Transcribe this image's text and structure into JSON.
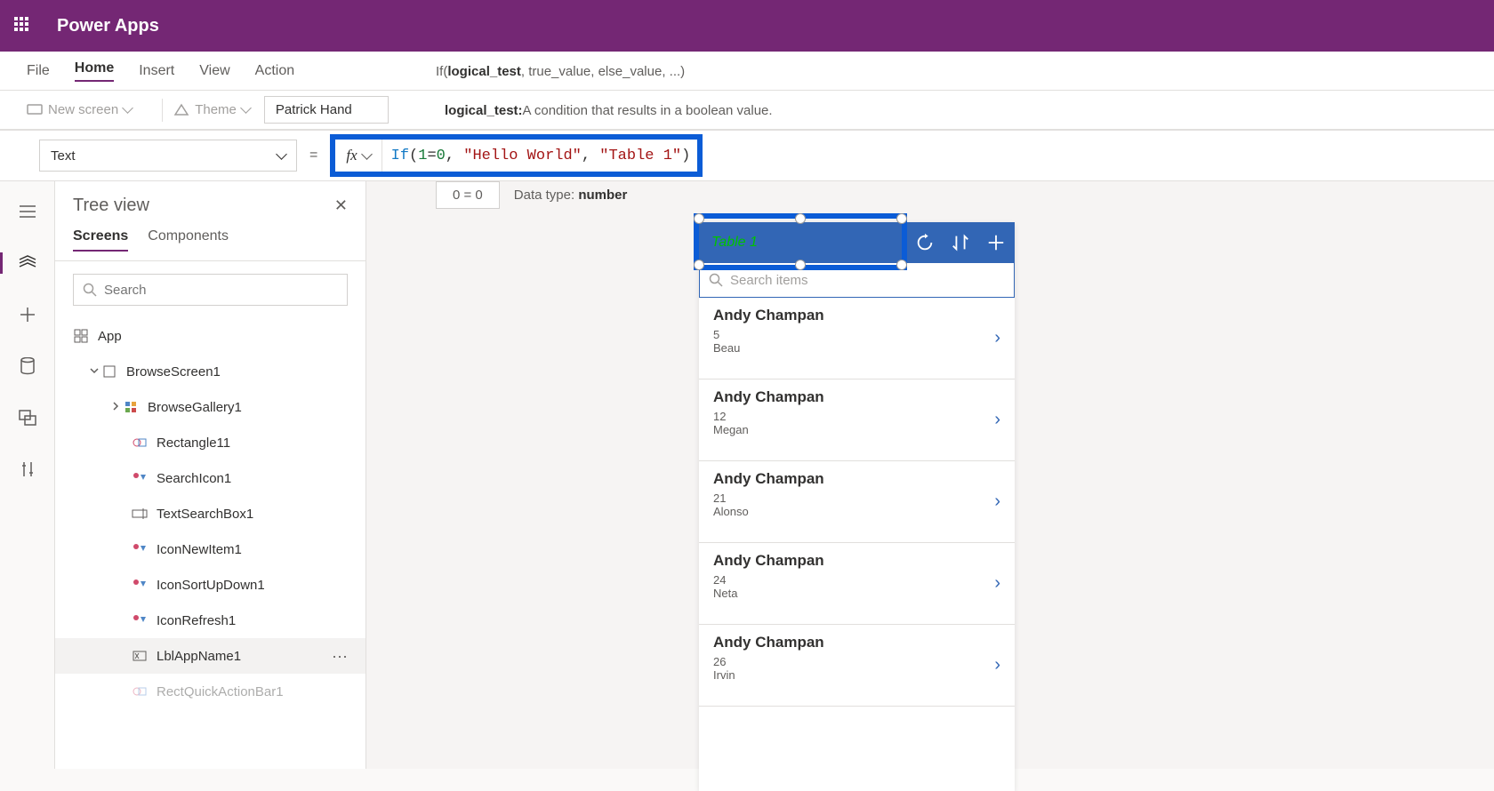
{
  "header": {
    "appTitle": "Power Apps"
  },
  "menu": {
    "file": "File",
    "home": "Home",
    "insert": "Insert",
    "view": "View",
    "action": "Action"
  },
  "toolbar": {
    "newScreen": "New screen",
    "theme": "Theme",
    "font": "Patrick Hand"
  },
  "formulaHelp": {
    "signature_prefix": "If(",
    "signature_bold": "logical_test",
    "signature_suffix": ", true_value, else_value, ...)",
    "desc_label": "logical_test:",
    "desc_text": " A condition that results in a boolean value."
  },
  "formula": {
    "property": "Text",
    "expr_func": "If",
    "expr_lp": "(",
    "expr_a": "1",
    "expr_eq": "=",
    "expr_b": "0",
    "expr_c1": ", ",
    "expr_s1": "\"Hello World\"",
    "expr_c2": ", ",
    "expr_s2": "\"Table 1\"",
    "expr_rp": ")"
  },
  "result": {
    "value": "0 = 0",
    "typeLabel": "Data type: ",
    "type": "number"
  },
  "tree": {
    "title": "Tree view",
    "tabs": {
      "screens": "Screens",
      "components": "Components"
    },
    "searchPlaceholder": "Search",
    "nodes": {
      "app": "App",
      "browseScreen": "BrowseScreen1",
      "browseGallery": "BrowseGallery1",
      "rect": "Rectangle11",
      "searchIcon": "SearchIcon1",
      "textSearch": "TextSearchBox1",
      "iconNew": "IconNewItem1",
      "iconSort": "IconSortUpDown1",
      "iconRefresh": "IconRefresh1",
      "lblApp": "LblAppName1",
      "lastItem": "RectQuickActionBar1"
    }
  },
  "device": {
    "title": "Table 1",
    "searchPlaceholder": "Search items",
    "items": [
      {
        "name": "Andy Champan",
        "num": "5",
        "sub": "Beau"
      },
      {
        "name": "Andy Champan",
        "num": "12",
        "sub": "Megan"
      },
      {
        "name": "Andy Champan",
        "num": "21",
        "sub": "Alonso"
      },
      {
        "name": "Andy Champan",
        "num": "24",
        "sub": "Neta"
      },
      {
        "name": "Andy Champan",
        "num": "26",
        "sub": "Irvin"
      }
    ]
  }
}
